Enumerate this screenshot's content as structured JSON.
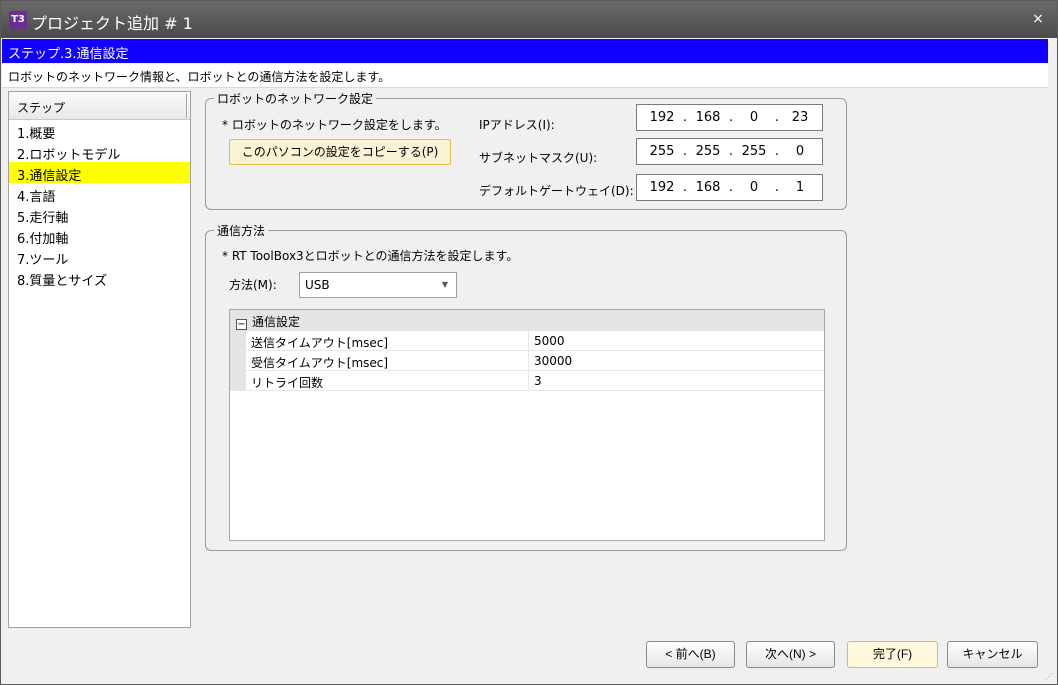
{
  "window": {
    "title": "プロジェクト追加 # 1",
    "icon_text": "T3",
    "close_label": "×"
  },
  "step_title": "ステップ.3.通信設定",
  "step_description": "ロボットのネットワーク情報と、ロボットとの通信方法を設定します。",
  "sidebar": {
    "header": "ステップ",
    "items": [
      {
        "label": "1.概要"
      },
      {
        "label": "2.ロボットモデル"
      },
      {
        "label": "3.通信設定"
      },
      {
        "label": "4.言語"
      },
      {
        "label": "5.走行軸"
      },
      {
        "label": "6.付加軸"
      },
      {
        "label": "7.ツール"
      },
      {
        "label": "8.質量とサイズ"
      }
    ],
    "active_index": 2
  },
  "network": {
    "group_title": "ロボットのネットワーク設定",
    "note": "* ロボットのネットワーク設定をします。",
    "copy_button": "このパソコンの設定をコピーする(P)",
    "ip_label": "IPアドレス(I):",
    "ip": [
      "192",
      "168",
      "0",
      "23"
    ],
    "subnet_label": "サブネットマスク(U):",
    "subnet": [
      "255",
      "255",
      "255",
      "0"
    ],
    "gateway_label": "デフォルトゲートウェイ(D):",
    "gateway": [
      "192",
      "168",
      "0",
      "1"
    ],
    "dot": "."
  },
  "comm": {
    "group_title": "通信方法",
    "note": "* RT ToolBox3とロボットとの通信方法を設定します。",
    "method_label": "方法(M):",
    "method_value": "USB",
    "grid_category": "通信設定",
    "grid_toggle": "−",
    "rows": [
      {
        "name": "送信タイムアウト[msec]",
        "value": "5000"
      },
      {
        "name": "受信タイムアウト[msec]",
        "value": "30000"
      },
      {
        "name": "リトライ回数",
        "value": "3"
      }
    ]
  },
  "buttons": {
    "back": "< 前へ(B)",
    "next": "次へ(N) >",
    "finish": "完了(F)",
    "cancel": "キャンセル"
  },
  "colors": {
    "step_bar": "#1200ff",
    "active_item": "#ffff00",
    "primary_border": "#e8b850"
  }
}
